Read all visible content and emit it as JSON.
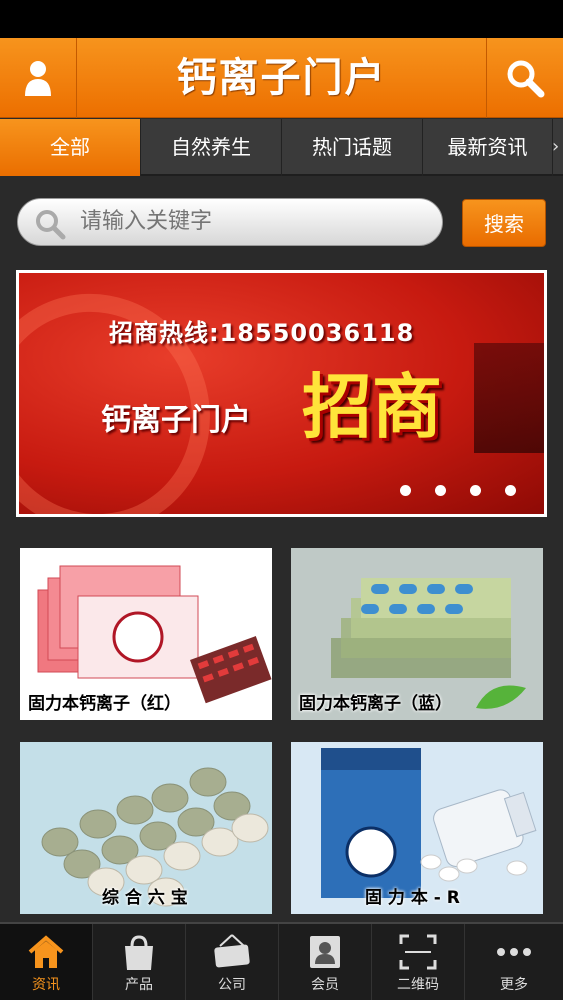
{
  "header": {
    "title": "钙离子门户"
  },
  "tabs": {
    "items": [
      "全部",
      "自然养生",
      "热门话题",
      "最新资讯"
    ],
    "active_index": 0,
    "left_arrow": "‹",
    "right_arrow": "›"
  },
  "search": {
    "placeholder": "请输入关键字",
    "button_label": "搜索"
  },
  "banner": {
    "hotline": "招商热线:18550036118",
    "brand": "钙离子门户",
    "headline": "招商",
    "slide_count": 4
  },
  "products": [
    {
      "caption": "固力本钙离子（红）"
    },
    {
      "caption": "固力本钙离子（蓝）"
    },
    {
      "caption": "综 合 六 宝"
    },
    {
      "caption": "固 力 本 - R"
    }
  ],
  "tabbar": {
    "items": [
      {
        "label": "资讯",
        "icon": "house-icon"
      },
      {
        "label": "产品",
        "icon": "shopping-bag-icon"
      },
      {
        "label": "公司",
        "icon": "open-sign-icon"
      },
      {
        "label": "会员",
        "icon": "member-card-icon"
      },
      {
        "label": "二维码",
        "icon": "qr-scan-icon"
      },
      {
        "label": "更多",
        "icon": "more-dots-icon"
      }
    ],
    "active_index": 0
  },
  "colors": {
    "accent": "#f7941d",
    "dark_bg": "#2a2a2a",
    "banner_red": "#c71a10",
    "headline_yellow": "#ffe43a"
  }
}
